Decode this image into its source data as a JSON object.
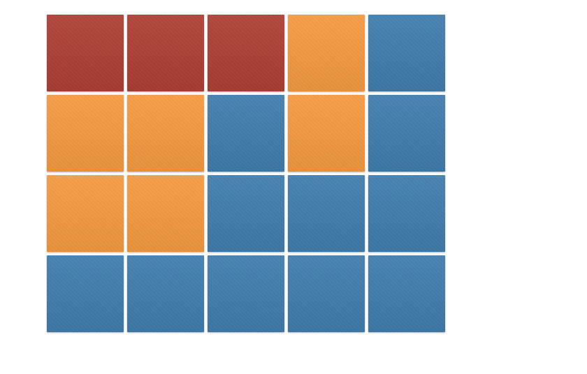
{
  "colors": {
    "red": "#AE3E33",
    "orange": "#F59A40",
    "blue": "#3F7DAE"
  },
  "grid": {
    "rows": 4,
    "cols": 5,
    "cells": [
      [
        "red",
        "red",
        "red",
        "orange",
        "blue"
      ],
      [
        "orange",
        "orange",
        "blue",
        "orange",
        "blue"
      ],
      [
        "orange",
        "orange",
        "blue",
        "blue",
        "blue"
      ],
      [
        "blue",
        "blue",
        "blue",
        "blue",
        "blue"
      ]
    ]
  }
}
